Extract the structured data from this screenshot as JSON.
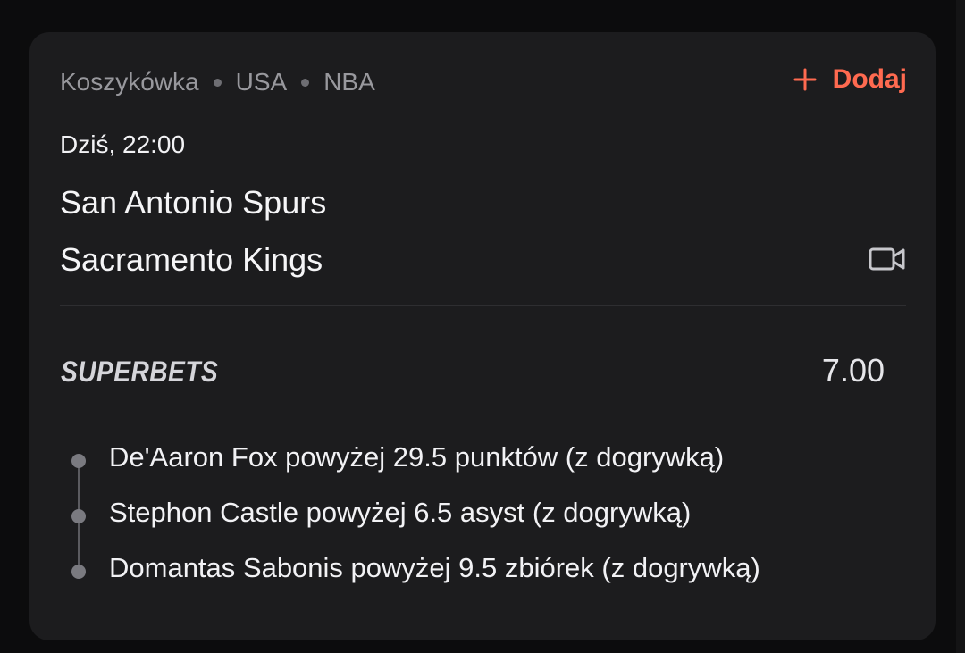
{
  "match": {
    "breadcrumb": [
      "Koszykówka",
      "USA",
      "NBA"
    ],
    "add_label": "Dodaj",
    "time": "Dziś, 22:00",
    "home_team": "San Antonio Spurs",
    "away_team": "Sacramento Kings",
    "video_icon": "video-camera-icon"
  },
  "superbets": {
    "title": "SUPERBETS",
    "odds": "7.00",
    "selections": [
      "De'Aaron Fox powyżej 29.5 punktów (z dogrywką)",
      "Stephon Castle powyżej 6.5 asyst (z dogrywką)",
      "Domantas Sabonis powyżej 9.5 zbiórek (z dogrywką)"
    ]
  },
  "colors": {
    "accent": "#ff6a50",
    "card_bg": "#1c1c1e",
    "page_bg": "#0c0c0d"
  }
}
